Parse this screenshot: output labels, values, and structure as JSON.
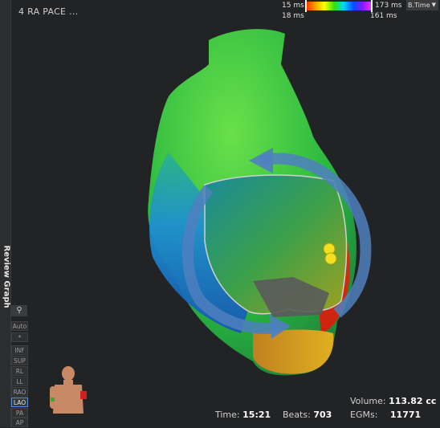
{
  "map": {
    "title": "4 RA PACE ..."
  },
  "sidebar": {
    "label": "Review Graph"
  },
  "scale": {
    "min_top": "15 ms",
    "min_bottom": "18 ms",
    "max_top": "173 ms",
    "max_bottom": "161 ms",
    "dropdown_label": "B.Time"
  },
  "view_controls": {
    "pin_icon": "pin-icon",
    "buttons": [
      "Auto",
      "*",
      "INF",
      "SUP",
      "RL",
      "LL",
      "RAO",
      "LAO",
      "PA",
      "AP"
    ],
    "active": "LAO"
  },
  "stats": {
    "volume_label": "Volume:",
    "volume_value": "113.82 cc",
    "time_label": "Time:",
    "time_value": "15:21",
    "beats_label": "Beats:",
    "beats_value": "703",
    "egms_label": "EGMs:",
    "egms_value": "11771"
  },
  "colors": {
    "background": "#222324",
    "arrow": "#4f7fc0",
    "active_border": "#5b8fd6"
  }
}
